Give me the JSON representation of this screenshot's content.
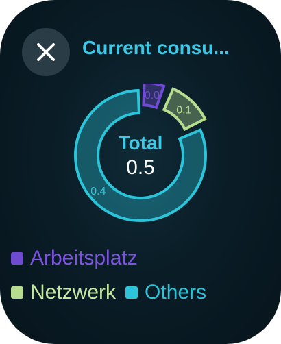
{
  "header": {
    "title": "Current consu...",
    "close_icon": "close-icon"
  },
  "chart_data": {
    "type": "pie",
    "categories": [
      "Arbeitsplatz",
      "Netzwerk",
      "Others"
    ],
    "values": [
      0.03,
      0.06,
      0.41
    ],
    "data_labels": [
      "0.0",
      "0.1",
      "0.4"
    ],
    "center_label": "Total",
    "center_value": "0.5",
    "colors": [
      "#6f4bd1",
      "#b6dc8e",
      "#2bc4d8"
    ]
  },
  "legend": {
    "items": [
      {
        "label": "Arbeitsplatz",
        "color": "#6f4bd1",
        "text_color": "#7c55dd"
      },
      {
        "label": "Netzwerk",
        "color": "#b6dc8e",
        "text_color": "#c4e8a0"
      },
      {
        "label": "Others",
        "color": "#2bc4d8",
        "text_color": "#2bc4d8"
      }
    ]
  },
  "colors": {
    "accent": "#3fc7e6",
    "background": "#0a1d27",
    "button_bg": "#2a3c45"
  }
}
